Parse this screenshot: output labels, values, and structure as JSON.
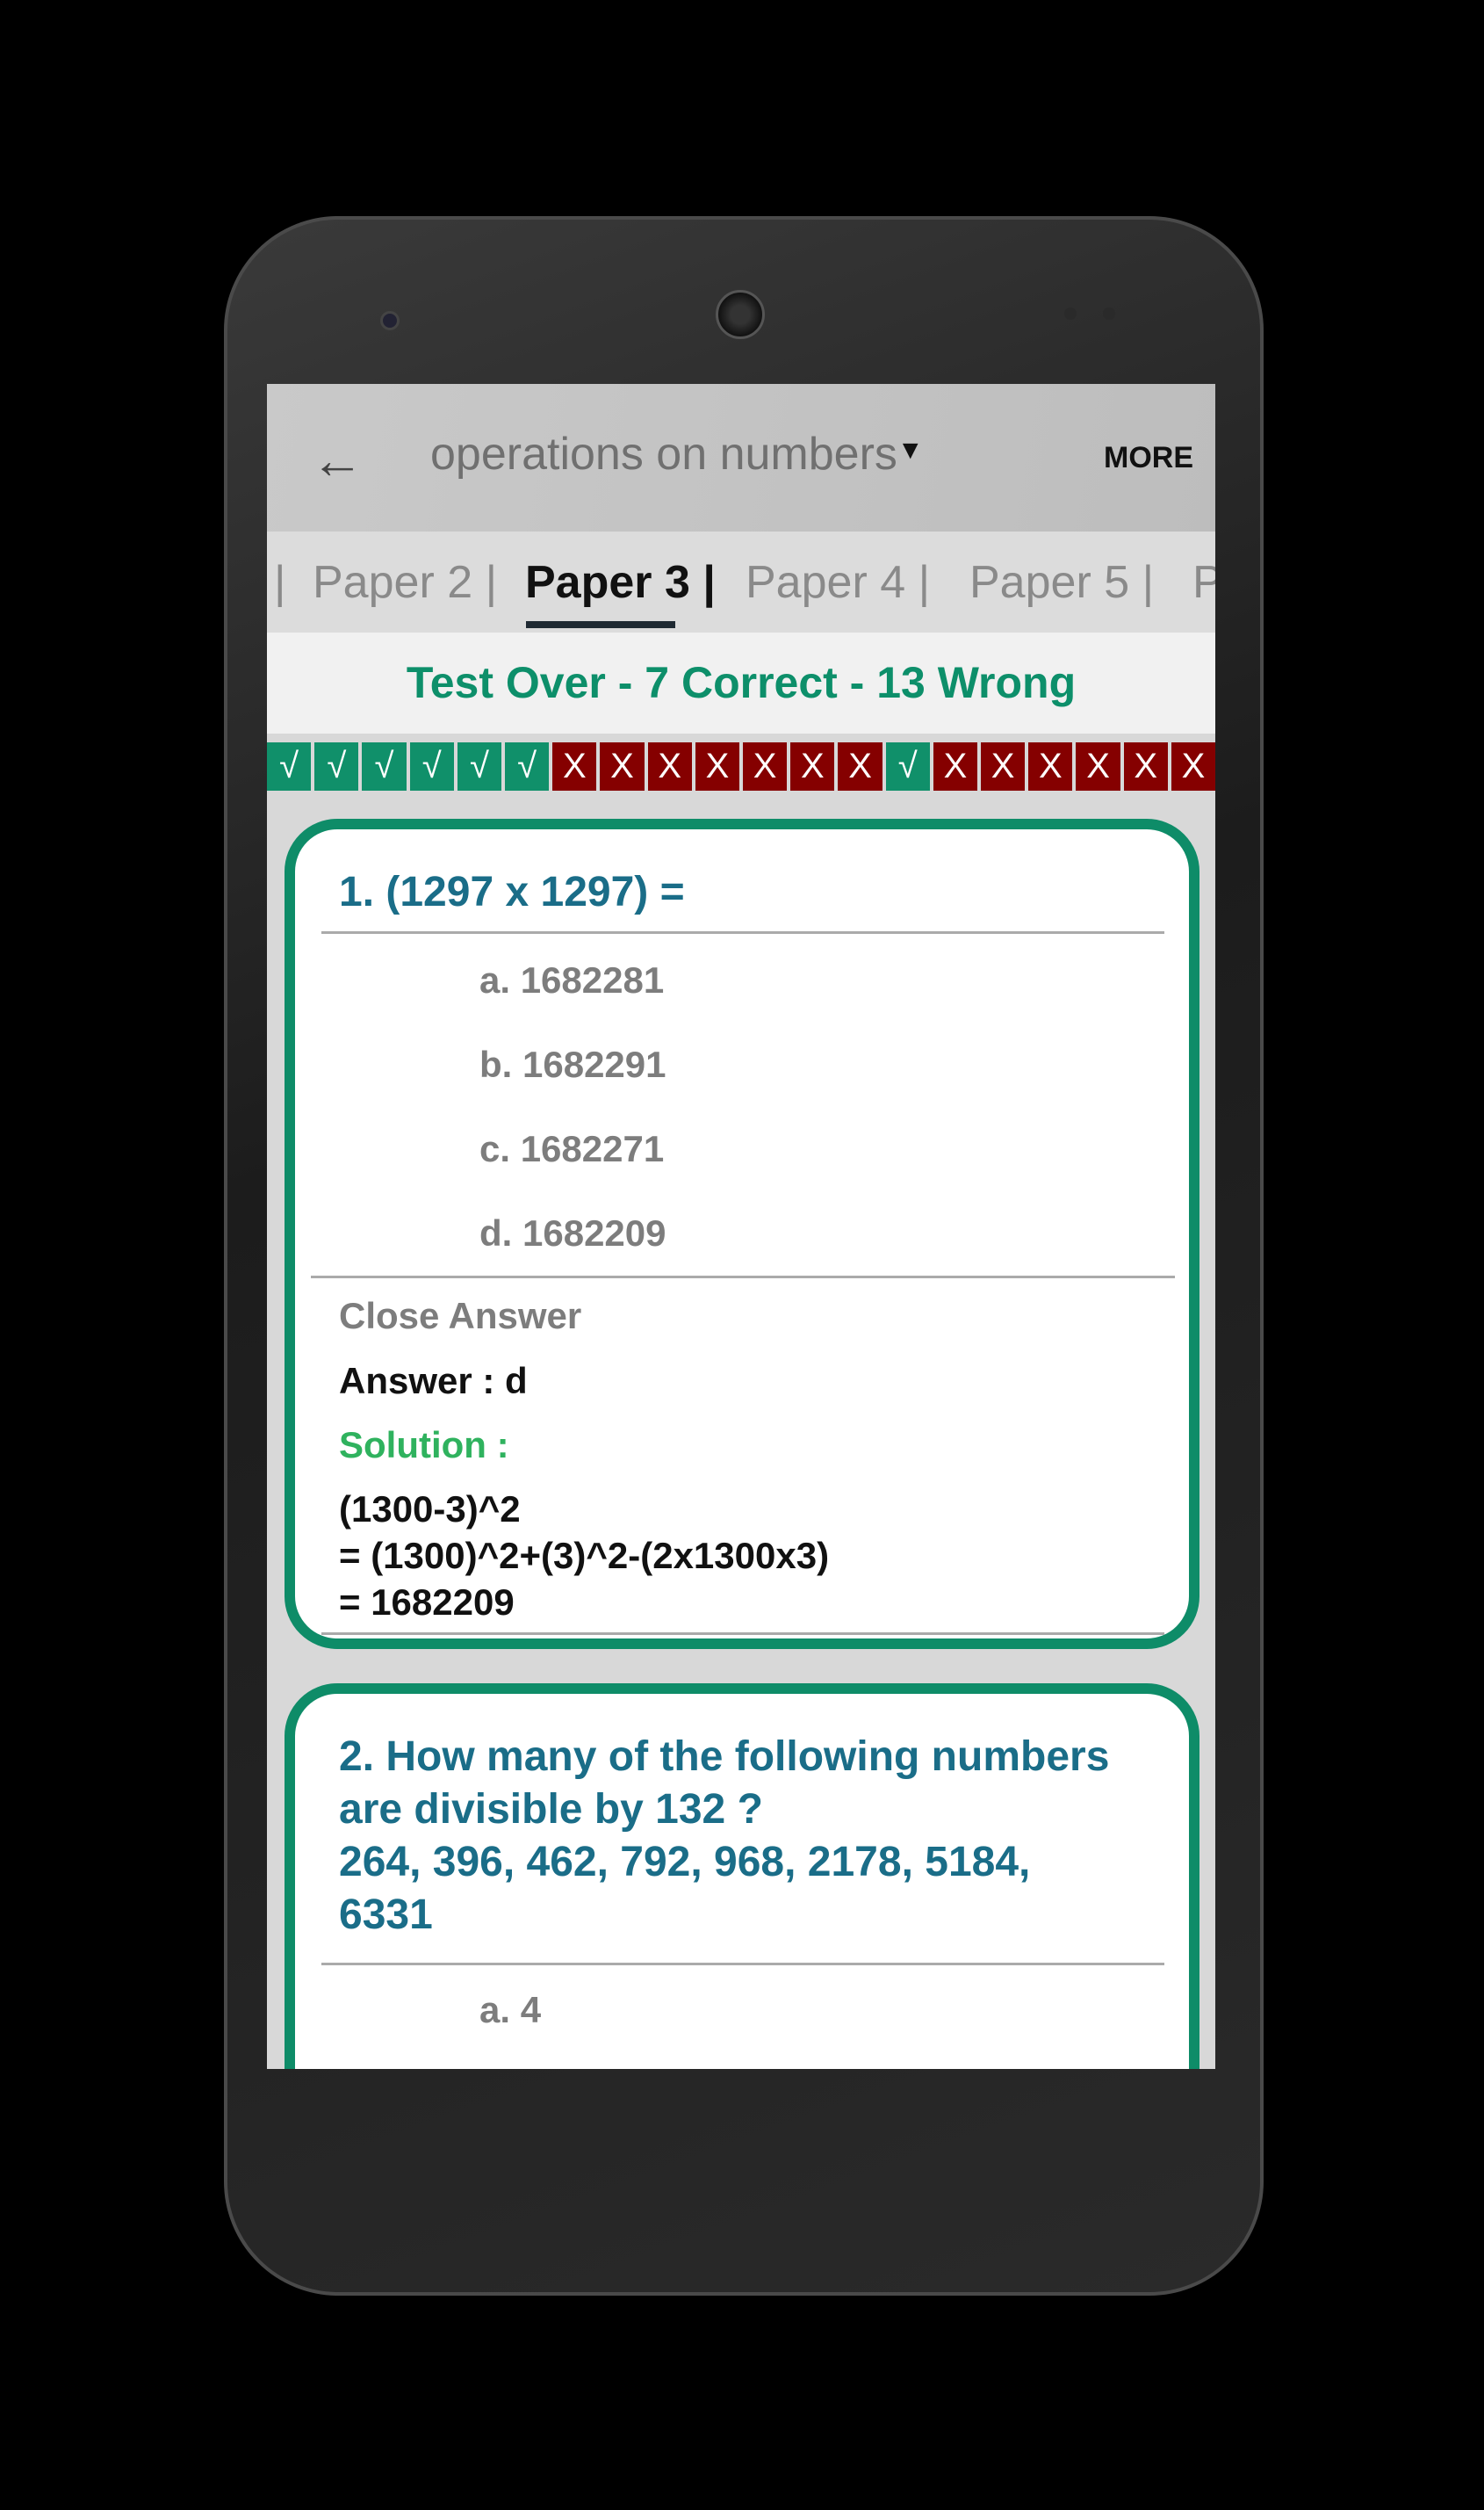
{
  "header": {
    "back_icon": "arrow-left-icon",
    "title": "operations on numbers",
    "dropdown_icon": "caret-down-icon",
    "more_label": "MORE"
  },
  "tabs": [
    {
      "label": "|"
    },
    {
      "label": "Paper 2 |"
    },
    {
      "label": "Paper 3 |",
      "active": true
    },
    {
      "label": "Paper 4 |"
    },
    {
      "label": "Paper 5 |"
    },
    {
      "label": "P"
    }
  ],
  "status": "Test Over -  7 Correct - 13 Wrong",
  "results": {
    "correct_symbol": "√",
    "wrong_symbol": "X",
    "colors": {
      "correct": "#10906a",
      "wrong": "#850000"
    },
    "items": [
      "correct",
      "correct",
      "correct",
      "correct",
      "correct",
      "correct",
      "wrong",
      "wrong",
      "wrong",
      "wrong",
      "wrong",
      "wrong",
      "wrong",
      "correct",
      "wrong",
      "wrong",
      "wrong",
      "wrong",
      "wrong",
      "wrong"
    ]
  },
  "questions": [
    {
      "text": "1. (1297 x 1297) =",
      "options": [
        "a. 1682281",
        "b. 1682291",
        "c. 1682271",
        "d. 1682209"
      ],
      "close_answer": "Close Answer",
      "answer": "Answer : d",
      "solution_label": "Solution :",
      "solution": [
        "(1300-3)^2",
        "= (1300)^2+(3)^2-(2x1300x3)",
        "= 1682209"
      ]
    },
    {
      "text_lines": [
        "2. How many of the following numbers",
        "are divisible by 132 ?",
        "264, 396, 462, 792, 968, 2178, 5184,",
        "6331"
      ],
      "options": [
        "a. 4"
      ]
    }
  ],
  "colors": {
    "accent": "#0e8c68",
    "question": "#1a6d88",
    "solution": "#2fb25e"
  }
}
